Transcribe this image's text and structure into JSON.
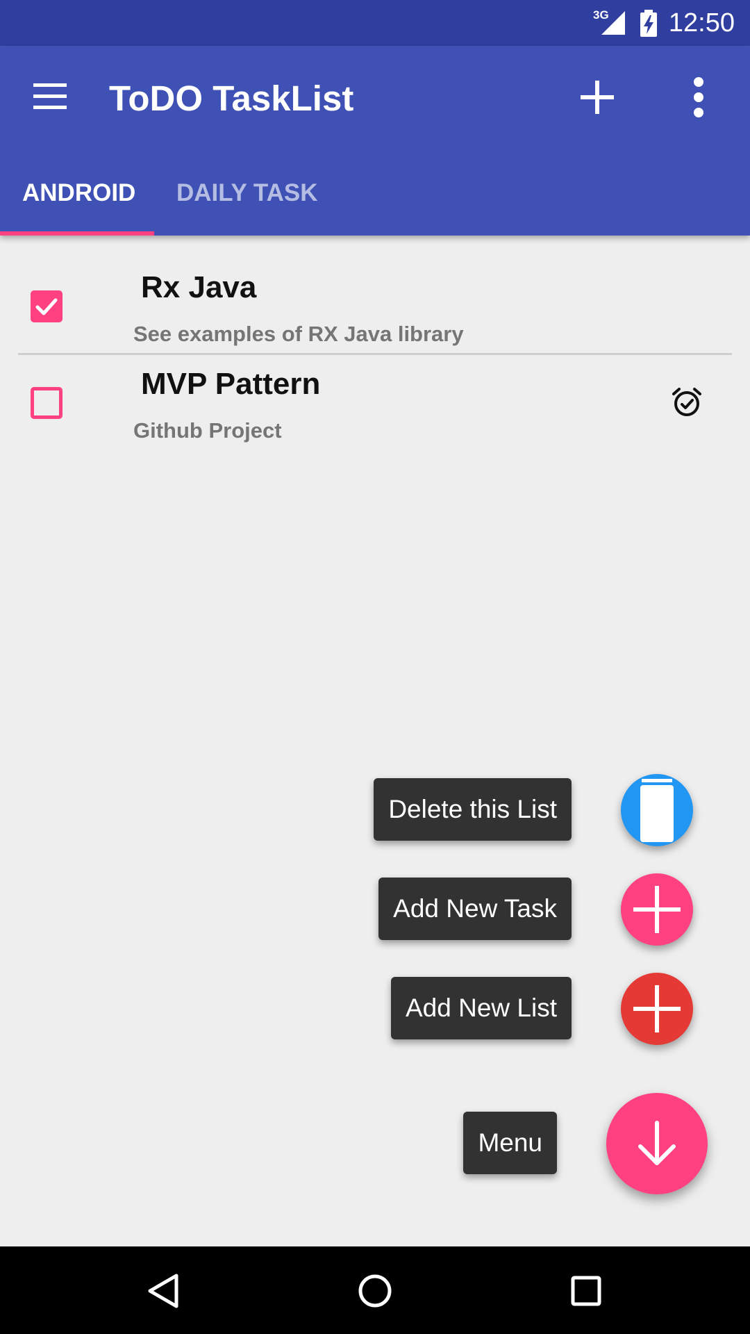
{
  "status_bar": {
    "time": "12:50",
    "network": "3G"
  },
  "toolbar": {
    "title": "ToDO TaskList"
  },
  "tabs": [
    {
      "label": "ANDROID",
      "selected": true
    },
    {
      "label": "DAILY TASK",
      "selected": false
    }
  ],
  "tasks": [
    {
      "title": "Rx Java",
      "description": "See examples of RX Java library",
      "checked": true,
      "has_alarm": false
    },
    {
      "title": "MVP Pattern",
      "description": "Github Project",
      "checked": false,
      "has_alarm": true
    }
  ],
  "fab_menu": {
    "delete_label": "Delete this List",
    "add_task_label": "Add New Task",
    "add_list_label": "Add New List",
    "menu_label": "Menu"
  },
  "colors": {
    "primary": "#3f51b5",
    "primary_dark": "#303f9f",
    "accent": "#ff4081",
    "delete_fab": "#2196f3",
    "add_list_fab": "#e53935"
  },
  "icons": {
    "toolbar": [
      "menu-icon",
      "add-icon",
      "overflow-icon"
    ],
    "status": [
      "signal-icon",
      "battery-charging-icon"
    ],
    "task": [
      "alarm-check-icon"
    ],
    "fab": [
      "trash-icon",
      "plus-icon",
      "arrow-down-icon"
    ],
    "nav": [
      "back-icon",
      "home-icon",
      "recents-icon"
    ]
  }
}
